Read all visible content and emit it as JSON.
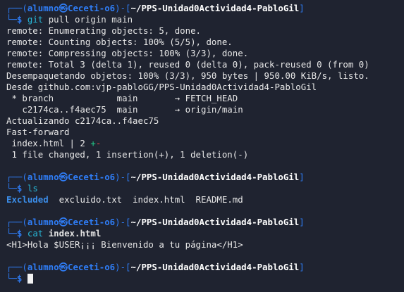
{
  "terminal": {
    "prompt": {
      "corner_top": "┌──(",
      "user": "alumno",
      "at_symbol": "㉿",
      "host": "Ceceti-o6",
      "sep": ")-[",
      "close": "]",
      "corner_bottom": "└─",
      "dollar": "$"
    },
    "blocks": [
      {
        "cwd": "~/PPS-Unidad0Actividad4-PabloGil",
        "command_name": "git",
        "command_args": " pull origin main",
        "output": [
          "remote: Enumerating objects: 5, done.",
          "remote: Counting objects: 100% (5/5), done.",
          "remote: Compressing objects: 100% (3/3), done.",
          "remote: Total 3 (delta 1), reused 0 (delta 0), pack-reused 0 (from 0)",
          "Desempaquetando objetos: 100% (3/3), 950 bytes | 950.00 KiB/s, listo.",
          "Desde github.com:vjp-pabloGG/PPS-Unidad0Actividad4-PabloGil",
          " * branch            main       → FETCH_HEAD",
          "   c2174ca..f4aec75  main       → origin/main",
          "Actualizando c2174ca..f4aec75",
          "Fast-forward"
        ],
        "diffstat": {
          "file": " index.html | 2 ",
          "plus": "+",
          "minus": "-"
        },
        "summary": " 1 file changed, 1 insertion(+), 1 deletion(-)"
      },
      {
        "cwd": "~/PPS-Unidad0Actividad4-PabloGil",
        "command_name": "ls",
        "command_args": "",
        "ls_entries": {
          "dir": "Excluded",
          "files": "  excluido.txt  index.html  README.md"
        }
      },
      {
        "cwd": "~/PPS-Unidad0Actividad4-PabloGil",
        "command_name": "cat",
        "command_args": "index.html",
        "output": [
          "<H1>Hola $USER¡¡¡ Bienvenido a tu página</H1>"
        ]
      },
      {
        "cwd": "~/PPS-Unidad0Actividad4-PabloGil"
      }
    ]
  },
  "colors": {
    "background": "#1f2330",
    "prompt_blue": "#2f7df6",
    "command_teal": "#27b7d7",
    "diff_add": "#23d18b",
    "diff_del": "#f14c4c",
    "directory_blue": "#3b8eea"
  }
}
